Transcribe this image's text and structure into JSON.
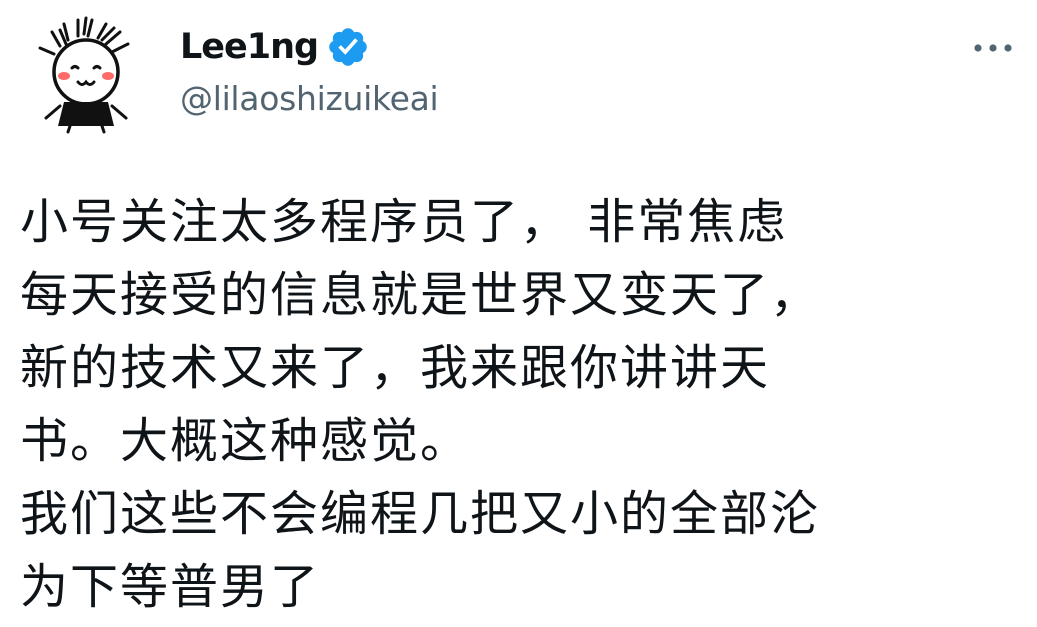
{
  "author": {
    "display_name": "Lee1ng",
    "handle": "@lilaoshizuikeai",
    "verified": true,
    "avatar_icon": "doodle-face-avatar-icon"
  },
  "actions": {
    "more_icon": "more-dots-icon"
  },
  "tweet": {
    "lines": [
      "小号关注太多程序员了， 非常焦虑",
      "每天接受的信息就是世界又变天了，",
      "新的技术又来了，我来跟你讲讲天",
      "书。大概这种感觉。",
      "我们这些不会编程几把又小的全部沦",
      "为下等普男了"
    ]
  },
  "colors": {
    "text_primary": "#0f1419",
    "text_secondary": "#536471",
    "verified_blue": "#1d9bf0",
    "background": "#ffffff"
  }
}
